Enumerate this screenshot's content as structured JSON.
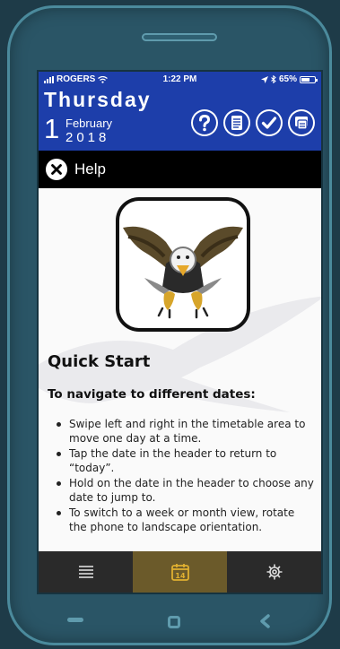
{
  "status_bar": {
    "carrier": "ROGERS",
    "time": "1:22 PM",
    "battery": "65%",
    "battery_level": 0.65
  },
  "header": {
    "day_name": "Thursday",
    "day_number": "1",
    "month": "February",
    "year": "2018",
    "icons": [
      "help-icon",
      "list-icon",
      "checkmark-icon",
      "document-icon"
    ]
  },
  "help_bar": {
    "title": "Help"
  },
  "content": {
    "quick_start_title": "Quick Start",
    "nav_heading": "To navigate to different dates:",
    "bullets": [
      "Swipe left and right in the timetable area to move one day at a time.",
      "Tap the date in the header to return to “today”.",
      "Hold on the date in the header to choose any date to jump to.",
      "To switch to a week or month view, rotate the phone to landscape orientation."
    ]
  },
  "tab_bar": {
    "tabs": [
      {
        "icon": "menu-icon",
        "active": false
      },
      {
        "icon": "calendar-icon",
        "label": "14",
        "active": true
      },
      {
        "icon": "gear-icon",
        "active": false
      }
    ]
  },
  "colors": {
    "header_blue": "#1d3eaa",
    "active_tab": "#6b5a2a",
    "calendar_gold": "#e0b030",
    "phone_body": "#2a5566"
  }
}
